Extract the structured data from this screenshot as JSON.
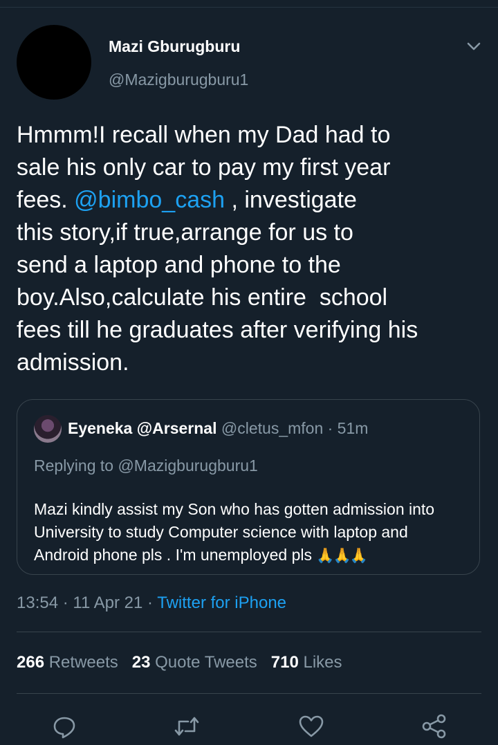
{
  "tweet": {
    "author_name": "Mazi Gburugburu",
    "author_handle": "@Mazigburugburu1",
    "text_part1": "Hmmm!I recall when my Dad had to\nsale his only car to pay my first year\nfees. ",
    "mention": "@bimbo_cash",
    "text_part2": " , investigate\nthis story,if true,arrange for us to\nsend a laptop and phone to the\nboy.Also,calculate his entire  school\nfees till he graduates after verifying his\nadmission."
  },
  "quote": {
    "name": "Eyeneka @Arsernal",
    "meta": " @cletus_mfon · 51m",
    "replying_to": "Replying to @Mazigburugburu1",
    "text": "Mazi kindly assist my Son who has gotten admission into University to study Computer science  with laptop and Android phone pls . I'm unemployed pls ",
    "emoji": "🙏🙏🙏"
  },
  "timestamp": {
    "time": "13:54",
    "date": " · 11 Apr 21 · ",
    "source": "Twitter for iPhone"
  },
  "stats": {
    "retweets_count": "266",
    "retweets_label": " Retweets",
    "quotes_count": "23",
    "quotes_label": " Quote Tweets",
    "likes_count": "710",
    "likes_label": " Likes"
  },
  "icons": {
    "reply": "reply-icon",
    "retweet": "retweet-icon",
    "like": "heart-icon",
    "share": "share-icon"
  },
  "colors": {
    "background": "#15202b",
    "accent": "#1da1f2",
    "secondary_text": "#8899a6"
  }
}
